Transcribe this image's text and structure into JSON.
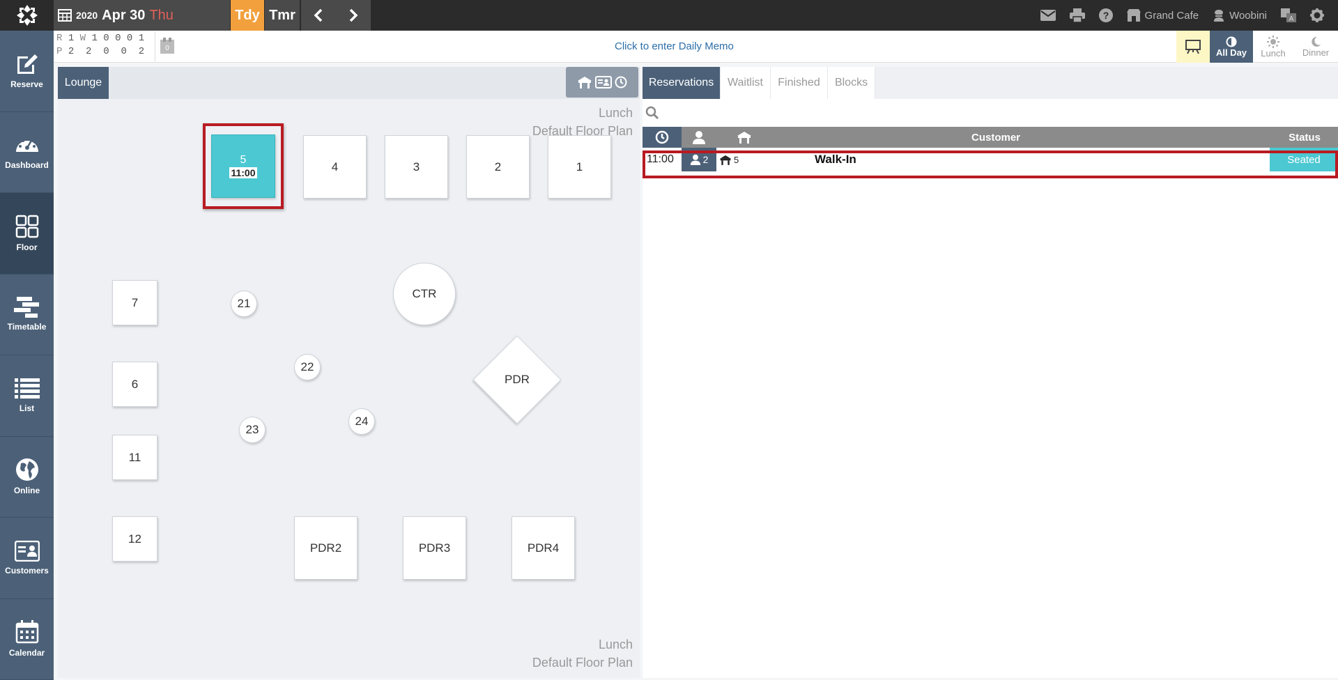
{
  "topbar": {
    "year": "2020",
    "month_day": "Apr 30",
    "weekday": "Thu",
    "today_label": "Tdy",
    "tomorrow_label": "Tmr",
    "restaurant": "Grand Cafe",
    "user": "Woobini"
  },
  "sidebar": {
    "items": [
      {
        "label": "Reserve",
        "icon": "edit-icon"
      },
      {
        "label": "Dashboard",
        "icon": "dashboard-icon"
      },
      {
        "label": "Floor",
        "icon": "floor-icon"
      },
      {
        "label": "Timetable",
        "icon": "timetable-icon"
      },
      {
        "label": "List",
        "icon": "list-icon"
      },
      {
        "label": "Online",
        "icon": "globe-icon"
      },
      {
        "label": "Customers",
        "icon": "customer-card-icon"
      },
      {
        "label": "Calendar",
        "icon": "calendar-icon"
      }
    ]
  },
  "stats": {
    "row1": {
      "label": "R",
      "values": [
        "1",
        "W",
        "1",
        "0",
        "0",
        "0",
        "1"
      ]
    },
    "row2": {
      "label": "P",
      "values": [
        "2",
        "2",
        "0",
        "0",
        "2"
      ]
    },
    "memo_badge": "0"
  },
  "memo": "Click to enter Daily Memo",
  "modes": {
    "all_day": "All Day",
    "lunch": "Lunch",
    "dinner": "Dinner"
  },
  "floor": {
    "tab": "Lounge",
    "label_service": "Lunch",
    "label_plan": "Default Floor Plan",
    "tables": [
      {
        "name": "5",
        "time": "11:00",
        "status": "occupied"
      },
      {
        "name": "4"
      },
      {
        "name": "3"
      },
      {
        "name": "2"
      },
      {
        "name": "1"
      },
      {
        "name": "7"
      },
      {
        "name": "21"
      },
      {
        "name": "CTR"
      },
      {
        "name": "22"
      },
      {
        "name": "PDR"
      },
      {
        "name": "6"
      },
      {
        "name": "24"
      },
      {
        "name": "23"
      },
      {
        "name": "11"
      },
      {
        "name": "12"
      },
      {
        "name": "PDR2"
      },
      {
        "name": "PDR3"
      },
      {
        "name": "PDR4"
      }
    ]
  },
  "reservations": {
    "tabs": [
      "Reservations",
      "Waitlist",
      "Finished",
      "Blocks"
    ],
    "columns": {
      "customer": "Customer",
      "status": "Status"
    },
    "rows": [
      {
        "time": "11:00",
        "party": "2",
        "table": "5",
        "customer": "Walk-In",
        "status": "Seated"
      }
    ]
  },
  "colors": {
    "sidebar": "#4c6178",
    "seated": "#4cc8d2",
    "today": "#f2a03d",
    "highlight": "#b81b22"
  }
}
